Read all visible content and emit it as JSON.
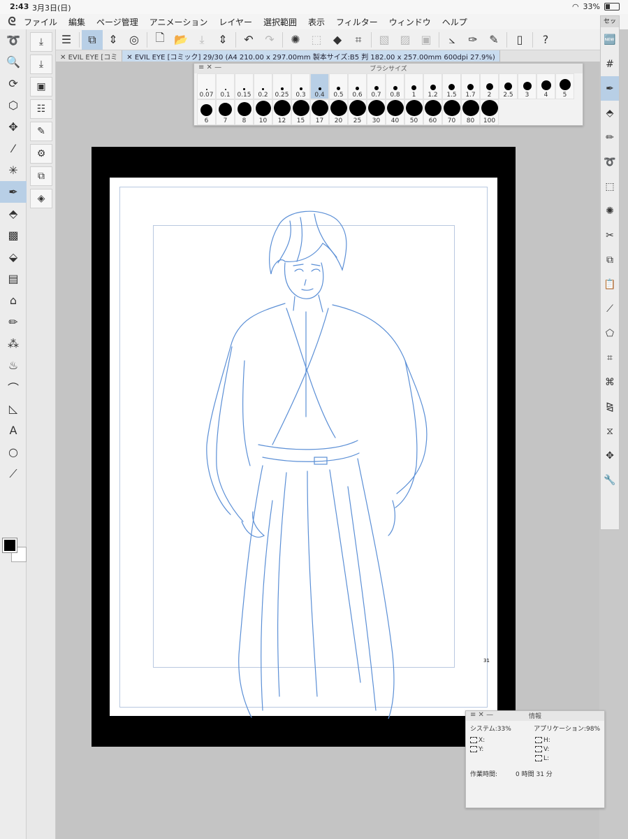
{
  "status": {
    "time": "2:43",
    "date": "3月3日(日)",
    "battery": "33%"
  },
  "menu": [
    "ファイル",
    "編集",
    "ページ管理",
    "アニメーション",
    "レイヤー",
    "選択範囲",
    "表示",
    "フィルター",
    "ウィンドウ",
    "ヘルプ"
  ],
  "tabs": [
    {
      "label": "EVIL EYE [コミ"
    },
    {
      "label": "EVIL EYE [コミック] 29/30 (A4 210.00 x 297.00mm 製本サイズ:B5 判 182.00 x 257.00mm 600dpi 27.9%)"
    }
  ],
  "brush_palette": {
    "title": "ブラシサイズ",
    "sizes": [
      "0.07",
      "0.1",
      "0.15",
      "0.2",
      "0.25",
      "0.3",
      "0.4",
      "0.5",
      "0.6",
      "0.7",
      "0.8",
      "1",
      "1.2",
      "1.5",
      "1.7",
      "2",
      "2.5",
      "3",
      "4",
      "5",
      "6",
      "7",
      "8",
      "10",
      "12",
      "15",
      "17",
      "20",
      "25",
      "30",
      "40",
      "50",
      "60",
      "70",
      "80",
      "100"
    ],
    "selected": "0.4"
  },
  "right_panel": {
    "title": "セッ"
  },
  "info": {
    "title": "情報",
    "system_label": "システム:33%",
    "app_label": "アプリケーション:98%",
    "x_label": "X:",
    "y_label": "Y:",
    "h_label": "H:",
    "v_label": "V:",
    "l_label": "L:",
    "work_time_label": "作業時間:",
    "work_time_value": "0 時間 31 分"
  },
  "page_number": "31"
}
